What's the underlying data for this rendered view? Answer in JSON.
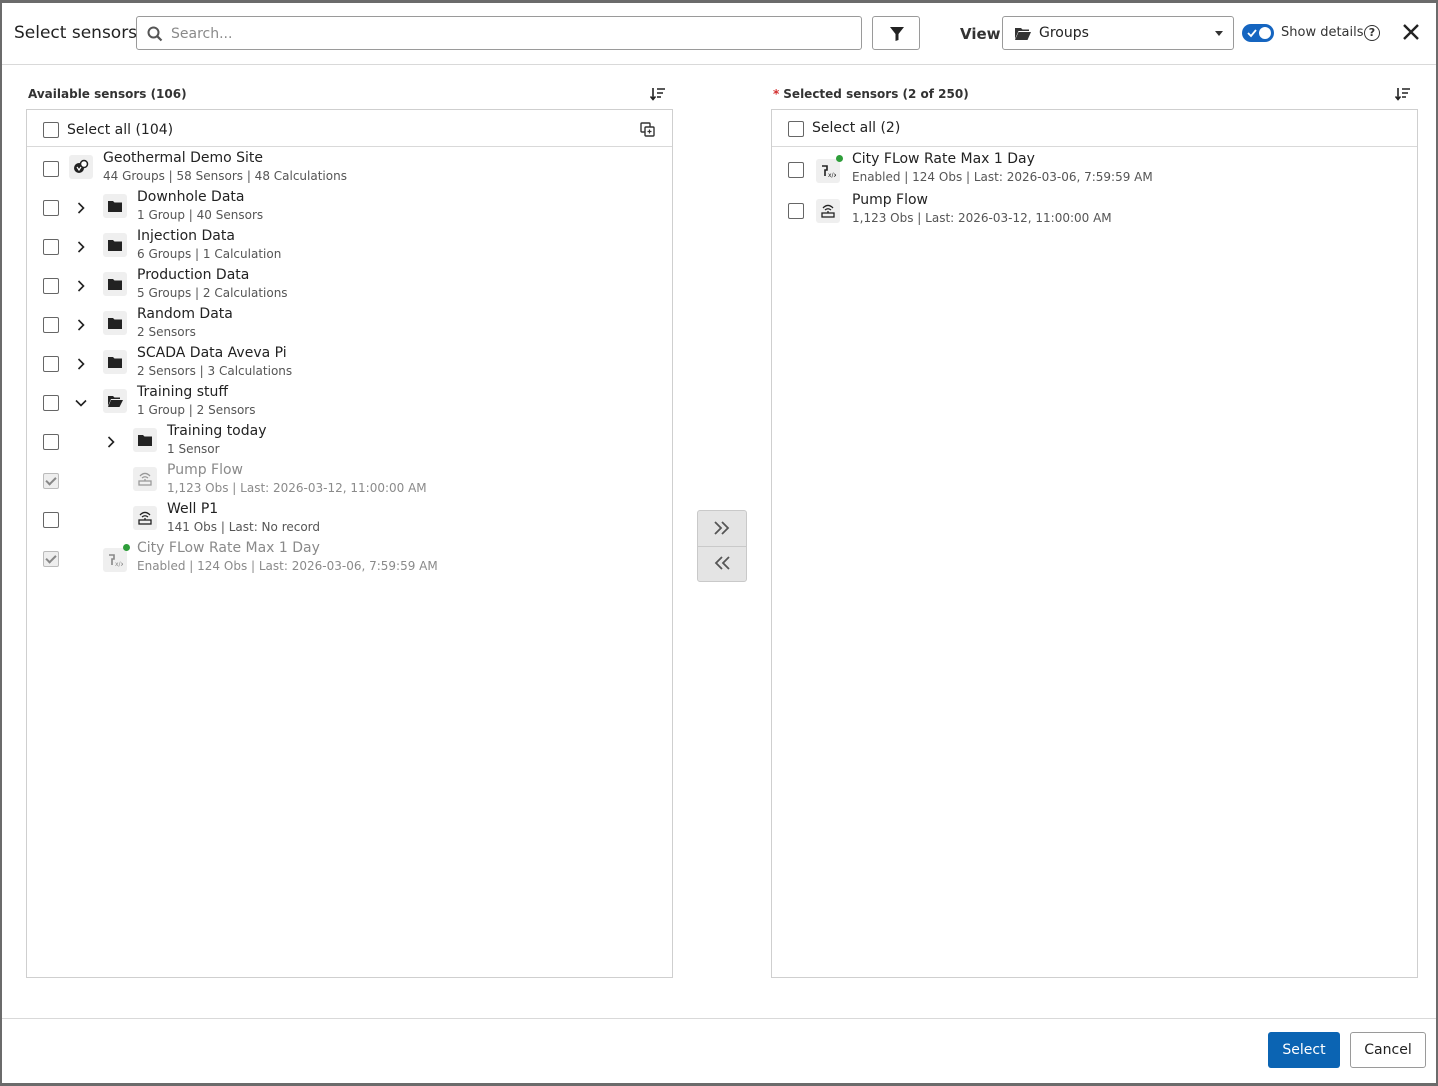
{
  "dialog": {
    "title": "Select sensors",
    "search_placeholder": "Search...",
    "view_label": "View",
    "view_value": "Groups",
    "show_details_label": "Show details",
    "show_details_on": true,
    "help_glyph": "?"
  },
  "available": {
    "label": "Available sensors (106)",
    "select_all": "Select all (104)",
    "rows": [
      {
        "name": "Geothermal Demo Site",
        "meta": "44 Groups | 58 Sensors | 48 Calculations",
        "icon": "site-icon"
      },
      {
        "name": "Downhole Data",
        "meta": "1 Group | 40 Sensors",
        "icon": "folder-icon"
      },
      {
        "name": "Injection Data",
        "meta": "6 Groups | 1 Calculation",
        "icon": "folder-icon"
      },
      {
        "name": "Production Data",
        "meta": "5 Groups | 2 Calculations",
        "icon": "folder-icon"
      },
      {
        "name": "Random Data",
        "meta": "2 Sensors",
        "icon": "folder-icon"
      },
      {
        "name": "SCADA Data Aveva Pi",
        "meta": "2 Sensors | 3 Calculations",
        "icon": "folder-icon"
      },
      {
        "name": "Training stuff",
        "meta": "1 Group | 2 Sensors",
        "icon": "folder-open-icon"
      },
      {
        "name": "Training today",
        "meta": "1 Sensor",
        "icon": "folder-icon"
      },
      {
        "name": "Pump Flow",
        "meta": "1,123 Obs | Last: 2026-03-12, 11:00:00 AM",
        "icon": "sensor-icon"
      },
      {
        "name": "Well P1",
        "meta": "141 Obs | Last: No record",
        "icon": "sensor-icon"
      },
      {
        "name": "City FLow Rate Max 1 Day",
        "meta": "Enabled | 124 Obs | Last: 2026-03-06, 7:59:59 AM",
        "icon": "calculation-icon"
      }
    ]
  },
  "selected": {
    "required_mark": "*",
    "label": "Selected sensors (2 of 250)",
    "select_all": "Select all (2)",
    "rows": [
      {
        "name": "City FLow Rate Max 1 Day",
        "meta": "Enabled | 124 Obs | Last: 2026-03-06, 7:59:59 AM",
        "icon": "calculation-icon"
      },
      {
        "name": "Pump Flow",
        "meta": "1,123 Obs | Last: 2026-03-12, 11:00:00 AM",
        "icon": "sensor-icon"
      }
    ]
  },
  "footer": {
    "select_label": "Select",
    "cancel_label": "Cancel"
  },
  "colors": {
    "primary": "#0b64b3",
    "toggle": "#1565c0",
    "status_dot": "#2e9e3a",
    "required": "#d32f2f"
  }
}
